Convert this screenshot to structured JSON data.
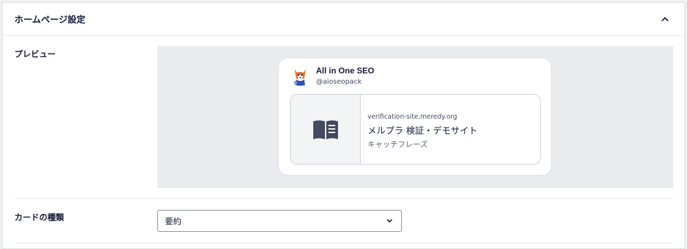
{
  "panel": {
    "title": "ホームページ設定",
    "collapse_icon": "chevron-up-icon"
  },
  "preview": {
    "label": "プレビュー",
    "account": {
      "name": "All in One SEO",
      "handle": "@aioseopack",
      "avatar_icon": "aioseo-mascot-avatar"
    },
    "card": {
      "thumbnail_icon": "book-icon",
      "domain": "verification-site.meredy.org",
      "title": "メルプラ 検証・デモサイト",
      "description": "キャッチフレーズ"
    }
  },
  "card_type": {
    "label": "カードの種類",
    "selected": "要約",
    "dropdown_icon": "chevron-down-icon"
  },
  "colors": {
    "text": "#141b38",
    "preview_bg": "#eaebef",
    "border": "#d0d1d7"
  }
}
